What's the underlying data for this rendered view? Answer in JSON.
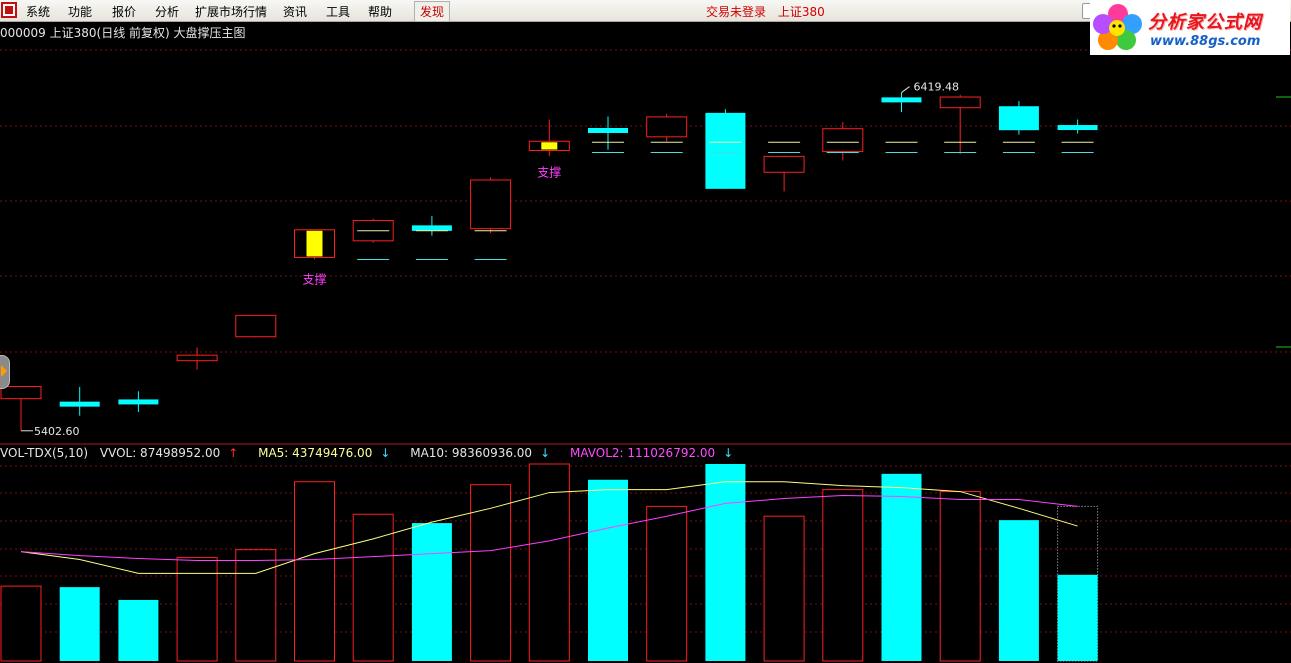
{
  "menubar": {
    "items": [
      "系统",
      "功能",
      "报价",
      "分析",
      "扩展市场行情",
      "资讯",
      "工具",
      "帮助"
    ],
    "discover": "发现",
    "trade_status": "交易未登录",
    "index_name": "上证380"
  },
  "brand": {
    "name": "分析家公式网",
    "url": "www.88gs.com"
  },
  "chart_title": "000009 上证380(日线 前复权) 大盘撑压主图",
  "colors": {
    "up": "#ff2020",
    "down": "#00ffff",
    "support": "#ffff00",
    "label": "#ff40ff",
    "grid": "#7a1010",
    "ma5": "#ffff80",
    "mavol2": "#ff40ff"
  },
  "chart_data": [
    {
      "type": "candlestick",
      "title": "000009 上证380(日线 前复权) 大盘撑压主图",
      "high_label": "6419.48",
      "low_label": "5402.60",
      "ylim": [
        5380,
        6470
      ],
      "candles": [
        {
          "o": 5492,
          "h": 5520,
          "l": 5405,
          "c": 5525,
          "dir": "up"
        },
        {
          "o": 5484,
          "h": 5524,
          "l": 5446,
          "c": 5475,
          "dir": "down"
        },
        {
          "o": 5490,
          "h": 5512,
          "l": 5456,
          "c": 5480,
          "dir": "down"
        },
        {
          "o": 5595,
          "h": 5631,
          "l": 5571,
          "c": 5610,
          "dir": "up"
        },
        {
          "o": 5660,
          "h": 5702,
          "l": 5658,
          "c": 5718,
          "dir": "up"
        },
        {
          "o": 5875,
          "h": 5915,
          "l": 5870,
          "c": 5950,
          "dir": "up",
          "support": true
        },
        {
          "o": 5920,
          "h": 5980,
          "l": 5915,
          "c": 5975,
          "dir": "up"
        },
        {
          "o": 5947,
          "h": 5987,
          "l": 5934,
          "c": 5962,
          "dir": "down"
        },
        {
          "o": 5953,
          "h": 6092,
          "l": 5941,
          "c": 6085,
          "dir": "up"
        },
        {
          "o": 6165,
          "h": 6249,
          "l": 6150,
          "c": 6190,
          "dir": "up",
          "support": true
        },
        {
          "o": 6226,
          "h": 6257,
          "l": 6167,
          "c": 6218,
          "dir": "down"
        },
        {
          "o": 6202,
          "h": 6264,
          "l": 6190,
          "c": 6256,
          "dir": "up"
        },
        {
          "o": 6267,
          "h": 6277,
          "l": 6061,
          "c": 6061,
          "dir": "down"
        },
        {
          "o": 6106,
          "h": 6151,
          "l": 6054,
          "c": 6149,
          "dir": "up"
        },
        {
          "o": 6224,
          "h": 6242,
          "l": 6138,
          "c": 6162,
          "dir": "up"
        },
        {
          "o": 6309,
          "h": 6322,
          "l": 6269,
          "c": 6297,
          "dir": "down"
        },
        {
          "o": 6281,
          "h": 6316,
          "l": 6155,
          "c": 6310,
          "dir": "up"
        },
        {
          "o": 6285,
          "h": 6299,
          "l": 6208,
          "c": 6220,
          "dir": "down"
        },
        {
          "o": 6234,
          "h": 6249,
          "l": 6211,
          "c": 6227,
          "dir": "down"
        }
      ],
      "support_markers": [
        {
          "index": 5,
          "label": "支撑"
        },
        {
          "index": 9,
          "label": "支撑"
        }
      ]
    },
    {
      "type": "bar",
      "title": "VOL-TDX(5,10)",
      "ylim": [
        0,
        200000000
      ],
      "values": [
        76000000,
        75000000,
        62000000,
        105000000,
        113000000,
        182000000,
        149000000,
        140000000,
        179000000,
        208000000,
        184000000,
        157000000,
        219000000,
        147000000,
        174000000,
        190000000,
        172000000,
        143000000,
        87498952
      ],
      "dirs": [
        "up",
        "down",
        "down",
        "up",
        "up",
        "up",
        "up",
        "down",
        "up",
        "up",
        "down",
        "up",
        "down",
        "up",
        "up",
        "down",
        "up",
        "down",
        "down"
      ],
      "ma5": [
        111000000,
        103000000,
        89000000,
        89000000,
        89000000,
        109000000,
        124000000,
        141000000,
        155000000,
        171000000,
        174000000,
        174000000,
        182000000,
        182000000,
        178000000,
        176000000,
        172000000,
        155000000,
        137000000
      ],
      "mavol2": [
        111000000,
        107000000,
        104000000,
        102000000,
        102000000,
        103000000,
        106000000,
        109000000,
        112000000,
        122000000,
        135000000,
        147000000,
        160000000,
        165000000,
        168000000,
        167000000,
        164000000,
        164000000,
        157000000
      ],
      "last_bar_partial": true
    }
  ],
  "vol_legend": {
    "name": "VOL-TDX(5,10)",
    "vol": "VVOL: 87498952.00",
    "ma5": "MA5: 43749476.00",
    "ma10": "MA10: 98360936.00",
    "mavol2": "MAVOL2: 111026792.00",
    "vol_arrow": "↑",
    "ma5_arrow": "↓",
    "ma10_arrow": "↓",
    "mavol2_arrow": "↓"
  }
}
